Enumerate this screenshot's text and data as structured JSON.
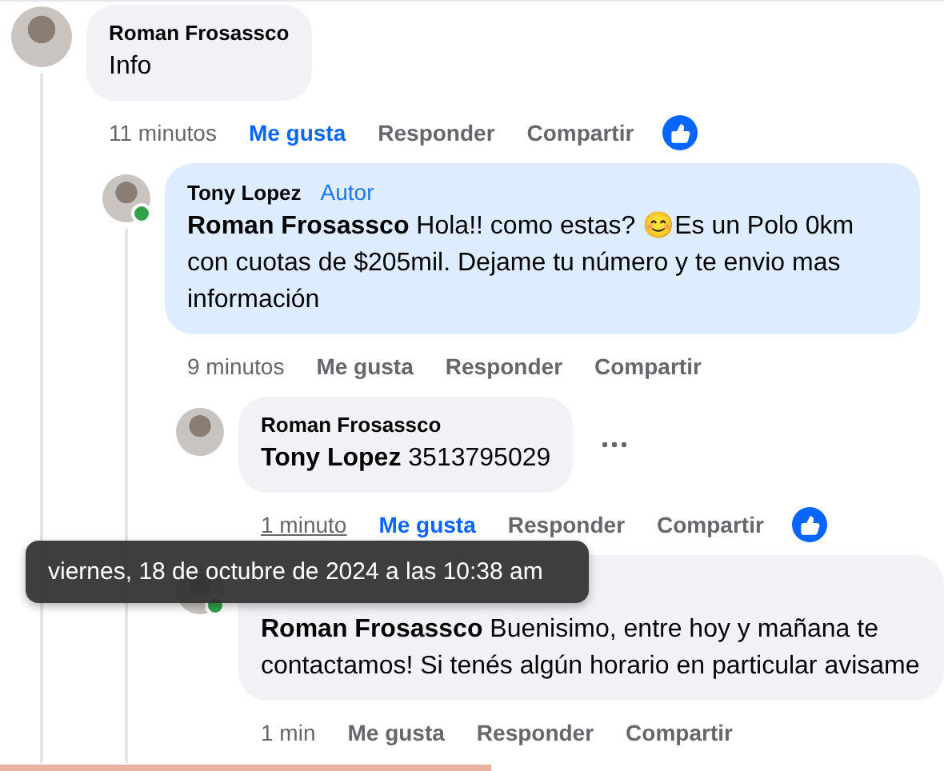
{
  "comments": [
    {
      "author": "Roman Frosassco",
      "text": "Info",
      "highlighted": false,
      "online": false,
      "menu_shown": false,
      "time": "11 minutos",
      "time_hovered": false,
      "liked": true,
      "reaction_shown": true,
      "actions": [
        "Me gusta",
        "Responder",
        "Compartir"
      ],
      "children": [
        {
          "author": "Tony Lopez",
          "badge": "Autor",
          "mention": "Roman Frosassco",
          "text": "Hola!! como estas? 😊Es un Polo 0km con cuotas de $205mil. Dejame tu número y te envio mas información",
          "highlighted": true,
          "online": true,
          "menu_shown": false,
          "time": "9 minutos",
          "time_hovered": false,
          "liked": false,
          "reaction_shown": false,
          "actions": [
            "Me gusta",
            "Responder",
            "Compartir"
          ],
          "children": [
            {
              "author": "Roman Frosassco",
              "mention": "Tony Lopez",
              "text": "3513795029",
              "highlighted": false,
              "online": false,
              "menu_shown": true,
              "time": "1 minuto",
              "time_hovered": true,
              "liked": true,
              "reaction_shown": true,
              "actions": [
                "Me gusta",
                "Responder",
                "Compartir"
              ]
            },
            {
              "mention": "Roman Frosassco",
              "text": "Buenisimo, entre hoy y mañana te contactamos! Si tenés algún horario en particular avisame",
              "highlighted": false,
              "online": true,
              "menu_shown": false,
              "time": "1 min",
              "time_hovered": false,
              "liked": false,
              "reaction_shown": false,
              "actions": [
                "Me gusta",
                "Responder",
                "Compartir"
              ]
            }
          ]
        }
      ]
    }
  ],
  "tooltip": {
    "text": "viernes, 18 de octubre de 2024 a las 10:38 am"
  }
}
